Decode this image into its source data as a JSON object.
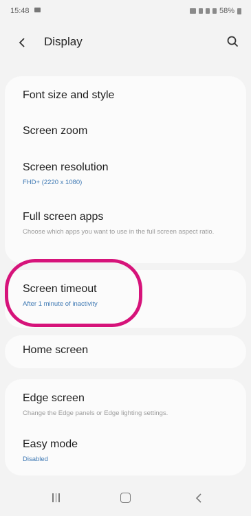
{
  "status_bar": {
    "time": "15:48",
    "icons_right": [
      "nfc-icon",
      "mute-icon",
      "wifi-icon",
      "signal-icon"
    ],
    "battery": "58%"
  },
  "header": {
    "title": "Display",
    "back_icon": "chevron-left-icon",
    "search_icon": "search-icon"
  },
  "settings": [
    {
      "title": "Font size and style",
      "subtitle": ""
    },
    {
      "title": "Screen zoom",
      "subtitle": ""
    },
    {
      "title": "Screen resolution",
      "subtitle": "FHD+ (2220 x 1080)"
    },
    {
      "title": "Full screen apps",
      "subtitle": "Choose which apps you want to use in the full screen aspect ratio."
    },
    {
      "title": "Screen timeout",
      "subtitle": "After 1 minute of inactivity"
    },
    {
      "title": "Home screen",
      "subtitle": ""
    },
    {
      "title": "Edge screen",
      "subtitle": "Change the Edge panels or Edge lighting settings."
    },
    {
      "title": "Easy mode",
      "subtitle": "Disabled"
    }
  ],
  "highlight_color": "#d6137a",
  "nav_bar": {
    "recents_icon": "recents-icon",
    "home_icon": "home-icon",
    "back_icon": "back-icon"
  }
}
